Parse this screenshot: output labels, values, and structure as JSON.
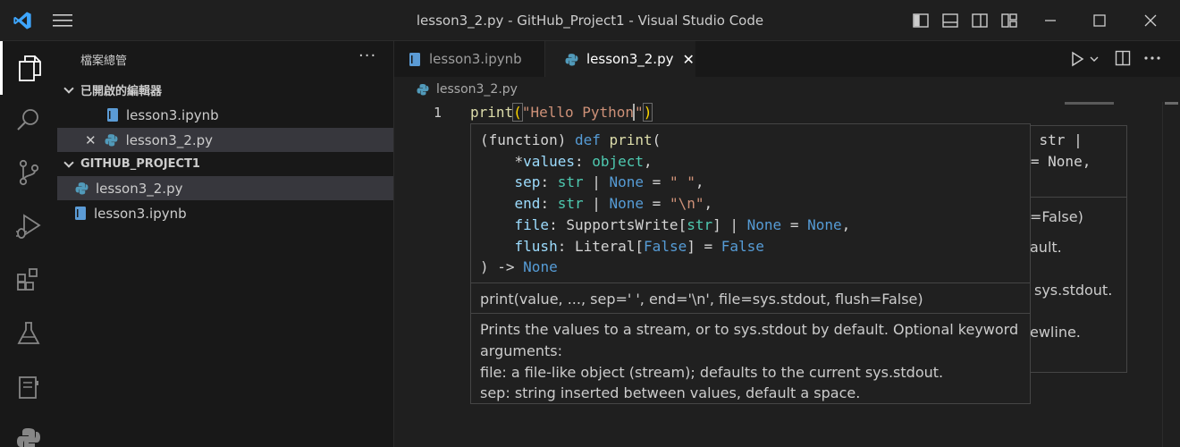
{
  "window": {
    "title": "lesson3_2.py - GitHub_Project1 - Visual Studio Code"
  },
  "colors": {
    "accent": "#0078d4",
    "python_blue": "#519aba",
    "notebook_blue": "#5b9bd5"
  },
  "sidebar": {
    "header": "檔案總管",
    "more": "···",
    "open_editors": {
      "title": "已開啟的編輯器",
      "items": [
        {
          "label": "lesson3.ipynb",
          "icon": "notebook-icon"
        },
        {
          "label": "lesson3_2.py",
          "icon": "python-icon",
          "close": "✕"
        }
      ]
    },
    "project": {
      "title": "GITHUB_PROJECT1",
      "items": [
        {
          "label": "lesson3_2.py",
          "icon": "python-icon"
        },
        {
          "label": "lesson3.ipynb",
          "icon": "notebook-icon"
        }
      ]
    }
  },
  "tabs": [
    {
      "label": "lesson3.ipynb",
      "icon": "notebook-icon"
    },
    {
      "label": "lesson3_2.py",
      "icon": "python-icon",
      "close": "✕"
    }
  ],
  "breadcrumb": {
    "file": "lesson3_2.py"
  },
  "editor": {
    "line_number": "1",
    "code": {
      "fn": "print",
      "open": "(",
      "string": "\"Hello Python",
      "string_end": "\"",
      "close": ")"
    }
  },
  "back_hover": {
    "line1": "nd: str |",
    "line2": "ne = None,",
    "line3": "=False)",
    "line4": "ault.",
    "line5": "sys.stdout.",
    "line6": "ewline."
  },
  "hover": {
    "sig": {
      "l1_a": "(function) ",
      "l1_kw": "def",
      "l1_fn": " print",
      "l1_b": "(",
      "l2_star": "    *",
      "l2_p": "values",
      "l2_c": ": ",
      "l2_t": "object",
      "l2_e": ",",
      "l3_i": "    ",
      "l3_p": "sep",
      "l3_c": ": ",
      "l3_t": "str",
      "l3_bar": " | ",
      "l3_n": "None",
      "l3_eq": " = ",
      "l3_s": "\" \"",
      "l3_e": ",",
      "l4_i": "    ",
      "l4_p": "end",
      "l4_c": ": ",
      "l4_t": "str",
      "l4_bar": " | ",
      "l4_n": "None",
      "l4_eq": " = ",
      "l4_s": "\"\\n\"",
      "l4_e": ",",
      "l5_i": "    ",
      "l5_p": "file",
      "l5_c": ": ",
      "l5_t": "SupportsWrite",
      "l5_o": "[",
      "l5_t2": "str",
      "l5_cb": "]",
      "l5_bar": " | ",
      "l5_n": "None",
      "l5_eq": " = ",
      "l5_n2": "None",
      "l5_e": ",",
      "l6_i": "    ",
      "l6_p": "flush",
      "l6_c": ": ",
      "l6_t": "Literal",
      "l6_o": "[",
      "l6_f": "False",
      "l6_cb": "]",
      "l6_eq": " = ",
      "l6_f2": "False",
      "l7_a": ") -> ",
      "l7_n": "None"
    },
    "doc_signature": "print(value, ..., sep=' ', end='\\n', file=sys.stdout, flush=False)",
    "doc_lines": [
      "Prints the values to a stream, or to sys.stdout by default. Optional keyword",
      "arguments:",
      "file: a file-like object (stream); defaults to the current sys.stdout.",
      "sep: string inserted between values, default a space."
    ]
  }
}
